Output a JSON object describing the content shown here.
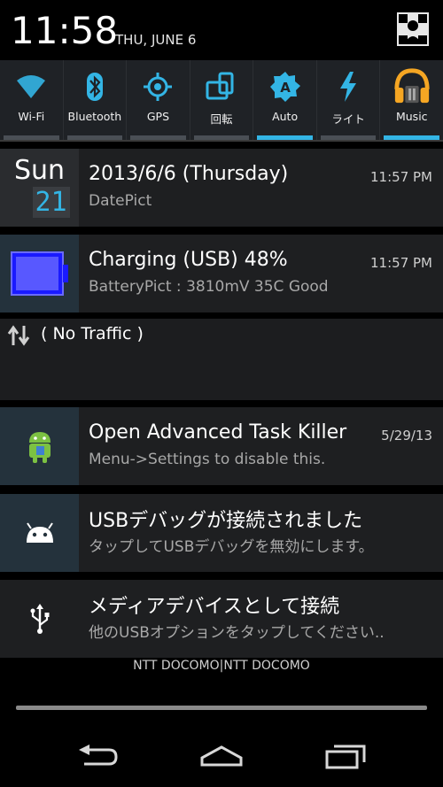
{
  "status": {
    "time": "11:58",
    "date": "THU, JUNE 6"
  },
  "toggles": [
    {
      "label": "Wi-Fi",
      "icon": "wifi-icon",
      "active": false
    },
    {
      "label": "Bluetooth",
      "icon": "bluetooth-icon",
      "active": false
    },
    {
      "label": "GPS",
      "icon": "gps-icon",
      "active": false
    },
    {
      "label": "回転",
      "icon": "rotation-icon",
      "active": false
    },
    {
      "label": "Auto",
      "icon": "auto-brightness-icon",
      "active": true
    },
    {
      "label": "ライト",
      "icon": "flashlight-icon",
      "active": false
    },
    {
      "label": "Music",
      "icon": "music-headphones-icon",
      "active": true
    }
  ],
  "notifications": {
    "datepict": {
      "icon_top": "Sun",
      "icon_day": "21",
      "title": "2013/6/6 (Thursday)",
      "subtitle": "DatePict",
      "time": "11:57 PM"
    },
    "battery": {
      "title": "Charging (USB) 48%",
      "subtitle": "BatteryPict : 3810mV 35C Good",
      "time": "11:57 PM"
    },
    "traffic": {
      "title": "( No Traffic )"
    },
    "taskkiller": {
      "title": "Open Advanced Task Killer",
      "subtitle": "Menu->Settings to disable this.",
      "time": "5/29/13"
    },
    "usbdebug": {
      "title": "USBデバッグが接続されました",
      "subtitle": "タップしてUSBデバッグを無効にします。"
    },
    "mediadevice": {
      "title": "メディアデバイスとして接続",
      "subtitle": "他のUSBオプションをタップしてください.."
    }
  },
  "carrier": "NTT DOCOMO|NTT DOCOMO",
  "colors": {
    "accent": "#33b5e5",
    "panel": "#1e1f21",
    "icon_bg": "#24323c"
  }
}
